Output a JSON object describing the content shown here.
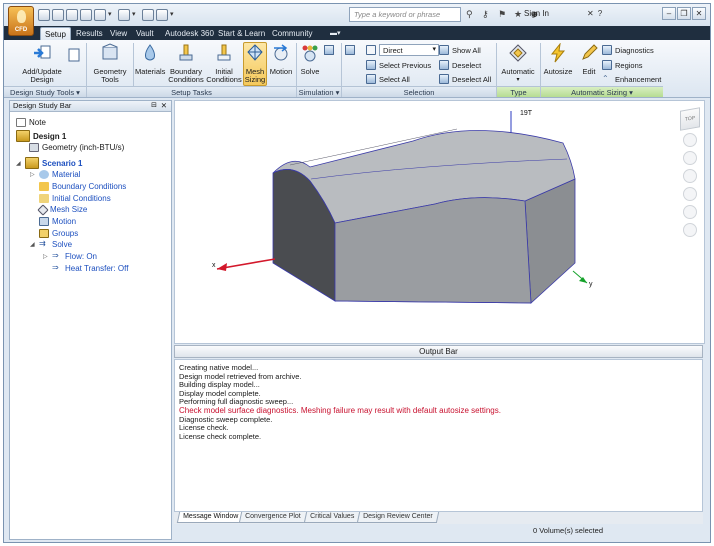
{
  "title_bar": {
    "app_logo_text": "CFD",
    "search_placeholder": "Type a keyword or phrase",
    "signin_label": "Sign In"
  },
  "tabs": [
    {
      "label": "Setup",
      "active": true
    },
    {
      "label": "Results",
      "active": false
    },
    {
      "label": "View",
      "active": false
    },
    {
      "label": "Vault",
      "active": false
    },
    {
      "label": "Autodesk 360",
      "active": false
    },
    {
      "label": "Start & Learn",
      "active": false
    },
    {
      "label": "Community",
      "active": false
    }
  ],
  "ribbon": {
    "design_study_tools": {
      "panel_label": "Design Study Tools ▾",
      "add_update_design": "Add/Update\nDesign"
    },
    "geometry_tools": "Geometry\nTools",
    "setup_tasks": {
      "panel_label": "Setup Tasks",
      "materials": "Materials",
      "boundary_conditions": "Boundary\nConditions",
      "initial_conditions": "Initial\nConditions",
      "mesh_sizing": "Mesh\nSizing",
      "motion": "Motion"
    },
    "simulation": {
      "panel_label": "Simulation ▾",
      "solve": "Solve"
    },
    "selection": {
      "panel_label": "Selection",
      "direct_combo": "Direct",
      "select_previous": "Select Previous",
      "select_all": "Select All",
      "show_all": "Show All",
      "deselect": "Deselect",
      "deselect_all": "Deselect All"
    },
    "type": {
      "panel_label": "Type",
      "automatic": "Automatic"
    },
    "automatic_sizing": {
      "panel_label": "Automatic Sizing ▾",
      "autosize": "Autosize",
      "edit": "Edit",
      "diagnostics": "Diagnostics",
      "regions": "Regions",
      "enhancement": "Enhancement"
    }
  },
  "design_study_bar": {
    "title": "Design Study Bar",
    "items": [
      {
        "label": "Note"
      },
      {
        "label": "Design 1"
      },
      {
        "label": "Geometry (inch-BTU/s)"
      },
      {
        "label": "Scenario 1"
      },
      {
        "label": "Material"
      },
      {
        "label": "Boundary Conditions"
      },
      {
        "label": "Initial Conditions"
      },
      {
        "label": "Mesh Size"
      },
      {
        "label": "Motion"
      },
      {
        "label": "Groups"
      },
      {
        "label": "Solve"
      },
      {
        "label": "Flow: On"
      },
      {
        "label": "Heat Transfer: Off"
      }
    ]
  },
  "viewport": {
    "node_label": "19T",
    "axis_x": "x",
    "axis_y": "y",
    "navcube_label": "TOP",
    "colors": {
      "face_top": "#b9bcc0",
      "face_front": "#4a4c50",
      "face_side": "#8b8e92",
      "outline": "#3a3aa8",
      "x_axis": "#d3182b",
      "y_axis": "#15a22a",
      "z_axis": "#2b3bc2"
    }
  },
  "output_bar": {
    "title": "Output Bar",
    "lines": [
      "Creating native model...",
      "Design model retrieved from archive.",
      "Building display model...",
      "Display model complete.",
      "Performing full diagnostic sweep...",
      "Check model surface diagnostics. Meshing failure may result with default autosize settings.",
      "Diagnostic sweep complete.",
      "License check.",
      "License check complete."
    ],
    "tabs": [
      "Message Window",
      "Convergence Plot",
      "Critical Values",
      "Design Review Center"
    ]
  },
  "status_bar": {
    "selection_text": "0 Volume(s) selected"
  }
}
